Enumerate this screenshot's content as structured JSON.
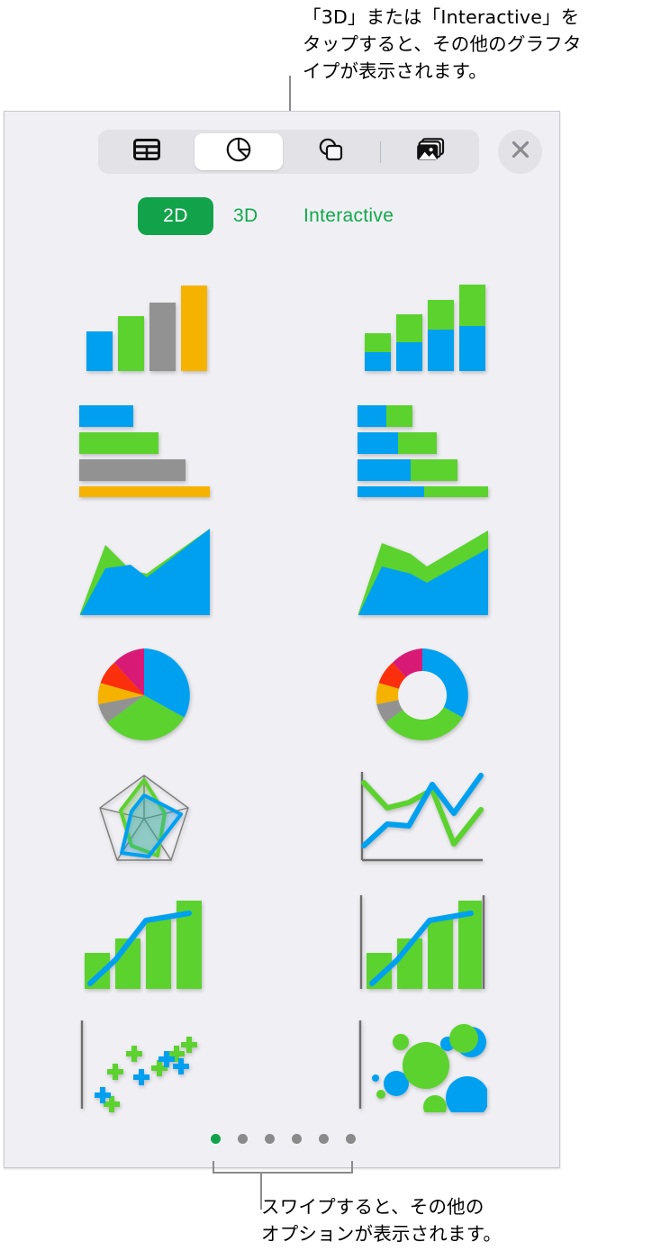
{
  "callouts": {
    "top": "「3D」または「Interactive」を\nタップすると、その他のグラフタ\nイプが表示されます。",
    "bottom": "スワイプすると、その他の\nオプションが表示されます。"
  },
  "toolbar": {
    "items": [
      {
        "name": "table-icon",
        "label": "Table",
        "selected": false
      },
      {
        "name": "chart-icon",
        "label": "Chart",
        "selected": true
      },
      {
        "name": "shapes-icon",
        "label": "Shapes",
        "selected": false
      },
      {
        "name": "media-icon",
        "label": "Media",
        "selected": false
      }
    ],
    "close_label": "Close"
  },
  "modes": {
    "two_d": "2D",
    "three_d": "3D",
    "interactive": "Interactive",
    "selected": "2D",
    "accent_color": "#12a34a"
  },
  "colors": {
    "blue": "#00a0f0",
    "green": "#5cd22e",
    "gray": "#929292",
    "orange": "#f5b300",
    "red": "#fb2f0b",
    "magenta": "#d81a76",
    "panel_bg": "#f0f0f4",
    "accent": "#12a34a"
  },
  "pager": {
    "count": 6,
    "active_index": 0
  },
  "chart_types": [
    {
      "index": 0,
      "name": "column-chart",
      "label": "Column"
    },
    {
      "index": 1,
      "name": "stacked-column-chart",
      "label": "Stacked Column"
    },
    {
      "index": 2,
      "name": "bar-chart",
      "label": "Bar"
    },
    {
      "index": 3,
      "name": "stacked-bar-chart",
      "label": "Stacked Bar"
    },
    {
      "index": 4,
      "name": "area-chart",
      "label": "Area"
    },
    {
      "index": 5,
      "name": "stacked-area-chart",
      "label": "Stacked Area"
    },
    {
      "index": 6,
      "name": "pie-chart",
      "label": "Pie"
    },
    {
      "index": 7,
      "name": "donut-chart",
      "label": "Donut"
    },
    {
      "index": 8,
      "name": "radar-chart",
      "label": "Radar"
    },
    {
      "index": 9,
      "name": "line-chart",
      "label": "Line"
    },
    {
      "index": 10,
      "name": "combo-chart",
      "label": "Combo"
    },
    {
      "index": 11,
      "name": "combo-axis-chart",
      "label": "Combo with Axis"
    },
    {
      "index": 12,
      "name": "scatter-chart",
      "label": "Scatter"
    },
    {
      "index": 13,
      "name": "bubble-chart",
      "label": "Bubble"
    }
  ],
  "chart_data": [
    {
      "type": "bar",
      "name": "column-chart",
      "title": "Column",
      "categories": [
        "1",
        "2",
        "3",
        "4"
      ],
      "values": [
        45,
        65,
        82,
        100
      ],
      "colors": [
        "#00a0f0",
        "#5cd22e",
        "#929292",
        "#f5b300"
      ],
      "ylim": [
        0,
        100
      ],
      "grid": false,
      "legend": "none"
    },
    {
      "type": "bar",
      "name": "stacked-column-chart",
      "title": "Stacked Column",
      "categories": [
        "1",
        "2",
        "3",
        "4"
      ],
      "series": [
        {
          "name": "blue",
          "values": [
            22,
            34,
            48,
            52
          ],
          "color": "#00a0f0"
        },
        {
          "name": "green",
          "values": [
            20,
            32,
            34,
            48
          ],
          "color": "#5cd22e"
        }
      ],
      "stacked": true,
      "ylim": [
        0,
        100
      ],
      "grid": false,
      "legend": "none"
    },
    {
      "type": "bar",
      "name": "bar-chart",
      "title": "Bar",
      "orientation": "horizontal",
      "categories": [
        "1",
        "2",
        "3",
        "4"
      ],
      "values": [
        41,
        60,
        80,
        100
      ],
      "colors": [
        "#00a0f0",
        "#5cd22e",
        "#929292",
        "#f5b300"
      ],
      "xlim": [
        0,
        100
      ],
      "grid": false,
      "legend": "none"
    },
    {
      "type": "bar",
      "name": "stacked-bar-chart",
      "title": "Stacked Bar",
      "orientation": "horizontal",
      "categories": [
        "1",
        "2",
        "3",
        "4"
      ],
      "series": [
        {
          "name": "blue",
          "values": [
            23,
            33,
            42,
            51
          ],
          "color": "#00a0f0"
        },
        {
          "name": "green",
          "values": [
            21,
            28,
            34,
            49
          ],
          "color": "#5cd22e"
        }
      ],
      "stacked": true,
      "xlim": [
        0,
        100
      ],
      "grid": false,
      "legend": "none"
    },
    {
      "type": "area",
      "name": "area-chart",
      "title": "Area",
      "x": [
        0,
        1,
        2,
        3,
        4
      ],
      "series": [
        {
          "name": "blue",
          "values": [
            2,
            48,
            44,
            22,
            100
          ],
          "color": "#00a0f0"
        },
        {
          "name": "green",
          "values": [
            4,
            72,
            52,
            26,
            100
          ],
          "color": "#5cd22e"
        }
      ],
      "ylim": [
        0,
        100
      ],
      "grid": false,
      "legend": "none"
    },
    {
      "type": "area",
      "name": "stacked-area-chart",
      "title": "Stacked Area",
      "x": [
        0,
        1,
        2,
        3,
        4
      ],
      "series": [
        {
          "name": "blue",
          "values": [
            2,
            50,
            42,
            36,
            86
          ],
          "color": "#00a0f0"
        },
        {
          "name": "green",
          "values": [
            6,
            78,
            62,
            54,
            100
          ],
          "color": "#5cd22e"
        }
      ],
      "stacked": true,
      "ylim": [
        0,
        100
      ],
      "grid": false,
      "legend": "none"
    },
    {
      "type": "pie",
      "name": "pie-chart",
      "title": "Pie",
      "labels": [
        "blue",
        "green",
        "gray",
        "orange",
        "red",
        "magenta"
      ],
      "values": [
        36,
        30,
        9,
        10,
        9,
        6
      ],
      "colors": [
        "#00a0f0",
        "#5cd22e",
        "#929292",
        "#f5b300",
        "#fb2f0b",
        "#d81a76"
      ],
      "legend": "none"
    },
    {
      "type": "pie",
      "name": "donut-chart",
      "title": "Donut",
      "donut": true,
      "hole": 0.52,
      "labels": [
        "blue",
        "green",
        "gray",
        "orange",
        "red",
        "magenta"
      ],
      "values": [
        36,
        30,
        9,
        10,
        9,
        6
      ],
      "colors": [
        "#00a0f0",
        "#5cd22e",
        "#929292",
        "#f5b300",
        "#fb2f0b",
        "#d81a76"
      ],
      "legend": "none"
    },
    {
      "type": "line",
      "name": "radar-chart",
      "title": "Radar",
      "radar": true,
      "axes": 5,
      "series": [
        {
          "name": "green",
          "values": [
            92,
            48,
            72,
            60,
            86
          ],
          "color": "#5cd22e"
        },
        {
          "name": "blue",
          "values": [
            55,
            88,
            46,
            84,
            40
          ],
          "color": "#00a0f0"
        }
      ],
      "rlim": [
        0,
        100
      ],
      "grid": true,
      "legend": "none"
    },
    {
      "type": "line",
      "name": "line-chart",
      "title": "Line",
      "x": [
        0,
        1,
        2,
        3,
        4,
        5
      ],
      "series": [
        {
          "name": "green",
          "values": [
            88,
            62,
            55,
            72,
            18,
            56
          ],
          "color": "#5cd22e"
        },
        {
          "name": "blue",
          "values": [
            14,
            44,
            40,
            86,
            52,
            94
          ],
          "color": "#00a0f0"
        }
      ],
      "ylim": [
        0,
        100
      ],
      "grid": false,
      "legend": "none"
    },
    {
      "type": "bar",
      "name": "combo-chart",
      "title": "Combo",
      "categories": [
        "1",
        "2",
        "3",
        "4"
      ],
      "series": [
        {
          "name": "bars",
          "values": [
            36,
            52,
            76,
            100
          ],
          "color": "#5cd22e",
          "type": "bar"
        },
        {
          "name": "line",
          "values": [
            8,
            30,
            68,
            80
          ],
          "color": "#00a0f0",
          "type": "line"
        }
      ],
      "ylim": [
        0,
        100
      ],
      "grid": false,
      "legend": "none"
    },
    {
      "type": "bar",
      "name": "combo-axis-chart",
      "title": "Combo with Axis",
      "categories": [
        "1",
        "2",
        "3",
        "4"
      ],
      "series": [
        {
          "name": "bars",
          "values": [
            36,
            52,
            76,
            100
          ],
          "color": "#5cd22e",
          "type": "bar"
        },
        {
          "name": "line",
          "values": [
            8,
            30,
            68,
            80
          ],
          "color": "#00a0f0",
          "type": "line"
        }
      ],
      "ylim": [
        0,
        100
      ],
      "grid": false,
      "axis": true,
      "legend": "none"
    },
    {
      "type": "scatter",
      "name": "scatter-chart",
      "title": "Scatter",
      "marker": "plus",
      "series": [
        {
          "name": "green",
          "x": [
            10,
            22,
            30,
            46,
            58,
            70,
            80
          ],
          "y": [
            18,
            44,
            60,
            34,
            50,
            66,
            72
          ],
          "color": "#5cd22e"
        },
        {
          "name": "blue",
          "x": [
            8,
            28,
            42,
            62,
            72,
            84
          ],
          "y": [
            8,
            26,
            40,
            58,
            48,
            68
          ],
          "color": "#00a0f0"
        }
      ],
      "axis": true,
      "grid": false,
      "legend": "none"
    },
    {
      "type": "scatter",
      "name": "bubble-chart",
      "title": "Bubble",
      "marker": "circle",
      "series": [
        {
          "name": "green",
          "x": [
            18,
            34,
            52,
            76,
            58
          ],
          "y": [
            14,
            50,
            60,
            78,
            10
          ],
          "size": [
            4,
            10,
            26,
            22,
            14
          ],
          "color": "#5cd22e"
        },
        {
          "name": "blue",
          "x": [
            10,
            30,
            66,
            80,
            84
          ],
          "y": [
            22,
            34,
            66,
            20,
            72
          ],
          "size": [
            3,
            16,
            10,
            28,
            16
          ],
          "color": "#00a0f0"
        }
      ],
      "axis": true,
      "grid": false,
      "legend": "none"
    }
  ]
}
